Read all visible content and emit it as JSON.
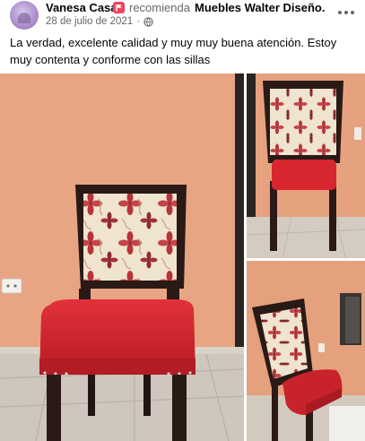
{
  "post": {
    "author": "Vanesa Casal",
    "recommends_text": "recomienda",
    "page_name": "Muebles Walter Diseño.",
    "date": "28 de julio de 2021",
    "separator": "·",
    "text": "La verdad, excelente calidad y muy muy buena atención. Estoy muy contenta y conforme con las sillas",
    "privacy_icon": "globe-icon",
    "recommend_icon": "recommend-flag-icon",
    "more_icon": "more-options-icon"
  },
  "photos": [
    {
      "subject": "chair-front-view"
    },
    {
      "subject": "chair-back-view"
    },
    {
      "subject": "chair-side-view"
    }
  ],
  "colors": {
    "wall": "#e8a583",
    "seat": "#d8262e",
    "wood": "#2a1a16",
    "fabric": "#efe4cf",
    "flower": "#b6333a",
    "recommend": "#f3425f",
    "secondary_text": "#65676b"
  }
}
